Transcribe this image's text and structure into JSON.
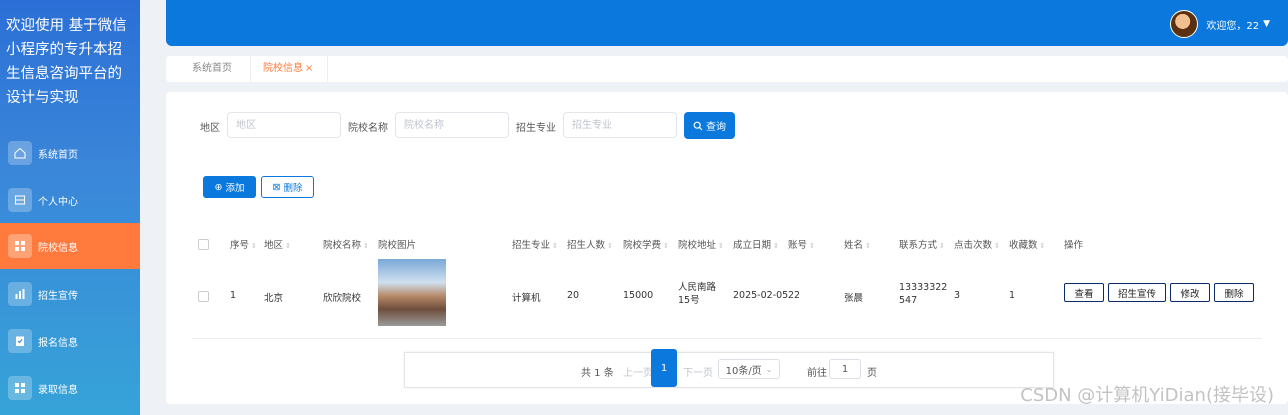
{
  "sidebar": {
    "title": "欢迎使用 基于微信小程序的专升本招生信息咨询平台的设计与实现",
    "items": [
      {
        "label": "系统首页",
        "icon": "home-icon"
      },
      {
        "label": "个人中心",
        "icon": "profile-icon"
      },
      {
        "label": "院校信息",
        "icon": "grid-icon",
        "active": true
      },
      {
        "label": "招生宣传",
        "icon": "chart-icon"
      },
      {
        "label": "报名信息",
        "icon": "form-icon"
      },
      {
        "label": "录取信息",
        "icon": "grid-icon"
      }
    ]
  },
  "header": {
    "user_text": "欢迎您，22"
  },
  "tabs": [
    {
      "label": "系统首页"
    },
    {
      "label": "院校信息"
    }
  ],
  "search": {
    "region_label": "地区",
    "region_placeholder": "地区",
    "school_label": "院校名称",
    "school_placeholder": "院校名称",
    "major_label": "招生专业",
    "major_placeholder": "招生专业",
    "query_button": "查询"
  },
  "toolbar": {
    "add_label": "添加",
    "delete_label": "删除"
  },
  "table": {
    "headers": [
      "序号",
      "地区",
      "院校名称",
      "院校图片",
      "招生专业",
      "招生人数",
      "院校学费",
      "院校地址",
      "成立日期",
      "账号",
      "姓名",
      "联系方式",
      "点击次数",
      "收藏数",
      "操作"
    ],
    "rows": [
      {
        "index": "1",
        "region": "北京",
        "school": "欣欣院校",
        "major": "计算机",
        "quota": "20",
        "tuition": "15000",
        "address": "人民南路15号",
        "founded": "2025-02-05",
        "account": "22",
        "name": "张晨",
        "phone": "13333322547",
        "clicks": "3",
        "favorites": "1"
      }
    ],
    "actions": [
      "查看",
      "招生宣传",
      "修改",
      "删除"
    ]
  },
  "pagination": {
    "total_text": "共 1 条",
    "prev": "上一页",
    "current": "1",
    "next": "下一页",
    "page_size": "10条/页",
    "goto_label": "前往",
    "goto_value": "1",
    "page_unit": "页"
  },
  "watermark": "CSDN @计算机YiDian(接毕设)",
  "colors": {
    "primary": "#0a78dc",
    "active_menu": "#ff7a3c"
  }
}
